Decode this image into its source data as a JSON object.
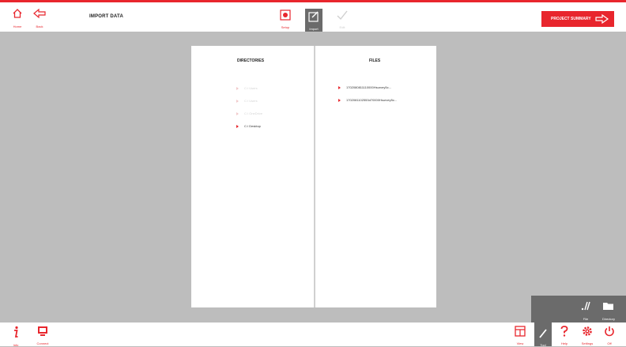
{
  "header": {
    "title": "IMPORT DATA",
    "home_label": "Home",
    "back_label": "Back",
    "steps": [
      {
        "label": "Setup",
        "icon": "setup-icon"
      },
      {
        "label": "Import",
        "icon": "import-icon"
      },
      {
        "label": "Edit",
        "icon": "checkmark-icon"
      }
    ],
    "summary_label": "PROJECT SUMMARY"
  },
  "directories": {
    "title": "DIRECTORIES",
    "items": [
      {
        "label": "C:\\ Users",
        "dimmed": true
      },
      {
        "label": "C:\\ Users",
        "dimmed": true
      },
      {
        "label": "C:\\ OneDrive",
        "dimmed": true
      },
      {
        "label": "C:\\ Desktop",
        "dimmed": false
      }
    ]
  },
  "files": {
    "title": "FILES",
    "items": [
      {
        "label": "1702080811110000Hsurvey5c..."
      },
      {
        "label": "1702081102553d70000Hsurvey5c..."
      }
    ]
  },
  "flyout": {
    "file_label": "File",
    "directory_label": "Directory"
  },
  "footer": {
    "info_label": "Info",
    "connect_label": "Connect",
    "view_label": "View",
    "tool_label": "Tool",
    "help_label": "Help",
    "settings_label": "Settings",
    "exit_label": "Off"
  },
  "colors": {
    "accent": "#e8262d",
    "dark": "#6b6b6b",
    "background": "#bdbdbd"
  }
}
